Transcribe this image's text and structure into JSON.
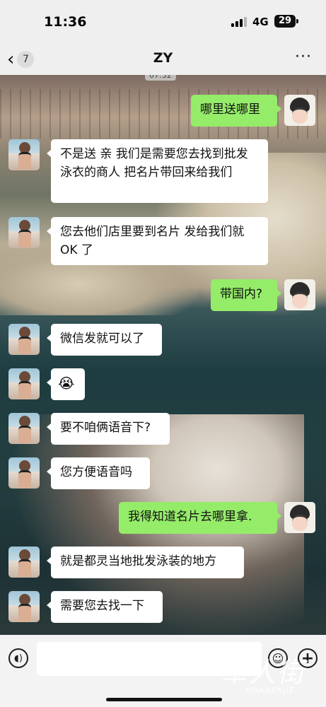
{
  "status_bar": {
    "time": "11:36",
    "network": "4G",
    "battery": "29"
  },
  "header": {
    "back_count": "7",
    "title": "ZY",
    "more": "···"
  },
  "chat": {
    "timestamp": "07:32",
    "messages": [
      {
        "side": "out",
        "text": "哪里送哪里"
      },
      {
        "side": "in",
        "text": "不是送 亲 我们是需要您去找到批发泳衣的商人 把名片带回来给我们"
      },
      {
        "side": "in",
        "text": "您去他们店里要到名片 发给我们就 OK 了"
      },
      {
        "side": "out",
        "text": "带国内?"
      },
      {
        "side": "in",
        "text": "微信发就可以了"
      },
      {
        "side": "in",
        "text": "😭"
      },
      {
        "side": "in",
        "text": "要不咱俩语音下?"
      },
      {
        "side": "in",
        "text": "您方便语音吗"
      },
      {
        "side": "out",
        "text": "我得知道名片去哪里拿."
      },
      {
        "side": "in",
        "text": "就是都灵当地批发泳装的地方"
      },
      {
        "side": "in",
        "text": "需要您去找一下"
      }
    ]
  },
  "input_bar": {
    "placeholder": ""
  },
  "watermark": {
    "cn": "華人街",
    "en": "HUARENJIE"
  },
  "colors": {
    "outgoing_bubble": "#95ec69",
    "incoming_bubble": "#ffffff",
    "bar_bg": "#efefef"
  }
}
